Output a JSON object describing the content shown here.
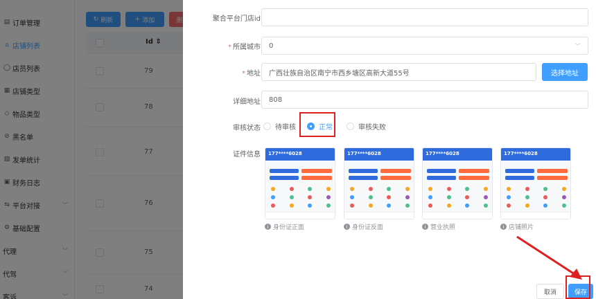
{
  "sidebar": {
    "items": [
      {
        "icon": "document-icon",
        "label": "订单管理",
        "active": false,
        "expandable": false
      },
      {
        "icon": "store-icon",
        "label": "店铺列表",
        "active": true,
        "expandable": false
      },
      {
        "icon": "user-icon",
        "label": "店员列表",
        "active": false,
        "expandable": false
      },
      {
        "icon": "grid-icon",
        "label": "店铺类型",
        "active": false,
        "expandable": false
      },
      {
        "icon": "tag-icon",
        "label": "物品类型",
        "active": false,
        "expandable": false
      },
      {
        "icon": "block-icon",
        "label": "黑名单",
        "active": false,
        "expandable": false
      },
      {
        "icon": "chart-icon",
        "label": "发单统计",
        "active": false,
        "expandable": false
      },
      {
        "icon": "log-icon",
        "label": "财务日志",
        "active": false,
        "expandable": false
      },
      {
        "icon": "link-icon",
        "label": "平台对接",
        "active": false,
        "expandable": true
      },
      {
        "icon": "gear-icon",
        "label": "基础配置",
        "active": false,
        "expandable": false
      },
      {
        "icon": "",
        "label": "代理",
        "active": false,
        "expandable": true
      },
      {
        "icon": "",
        "label": "代驾",
        "active": false,
        "expandable": true
      },
      {
        "icon": "",
        "label": "客诉",
        "active": false,
        "expandable": true
      }
    ]
  },
  "toolbar": {
    "refresh_label": "刷新",
    "add_label": "添加",
    "delete_label": "删"
  },
  "table": {
    "id_header": "Id",
    "rows": [
      {
        "id": "79"
      },
      {
        "id": "78"
      },
      {
        "id": "77"
      },
      {
        "id": "76"
      },
      {
        "id": "75"
      },
      {
        "id": "74"
      }
    ]
  },
  "form": {
    "platform_store_id": {
      "label": "聚合平台门店id",
      "value": ""
    },
    "city": {
      "label": "所属城市",
      "required": true,
      "value": "0"
    },
    "address": {
      "label": "地址",
      "required": true,
      "value": "广西壮族自治区南宁市西乡塘区高新大道55号",
      "pick_label": "选择地址"
    },
    "detail_address": {
      "label": "详细地址",
      "value": "808"
    },
    "audit_status": {
      "label": "审核状态",
      "options": [
        {
          "label": "待审核",
          "checked": false
        },
        {
          "label": "正常",
          "checked": true
        },
        {
          "label": "审核失败",
          "checked": false
        }
      ]
    },
    "certificates": {
      "label": "证件信息",
      "items": [
        {
          "caption": "身份证正面",
          "phone_number": "177****6028"
        },
        {
          "caption": "身份证反面",
          "phone_number": "177****6028"
        },
        {
          "caption": "营业执照",
          "phone_number": "177****6028"
        },
        {
          "caption": "店铺照片",
          "phone_number": "177****6028"
        }
      ]
    }
  },
  "footer": {
    "cancel_label": "取消",
    "save_label": "保存"
  },
  "colors": {
    "primary": "#409eff",
    "danger": "#f56c6c",
    "highlight": "#e02020"
  }
}
